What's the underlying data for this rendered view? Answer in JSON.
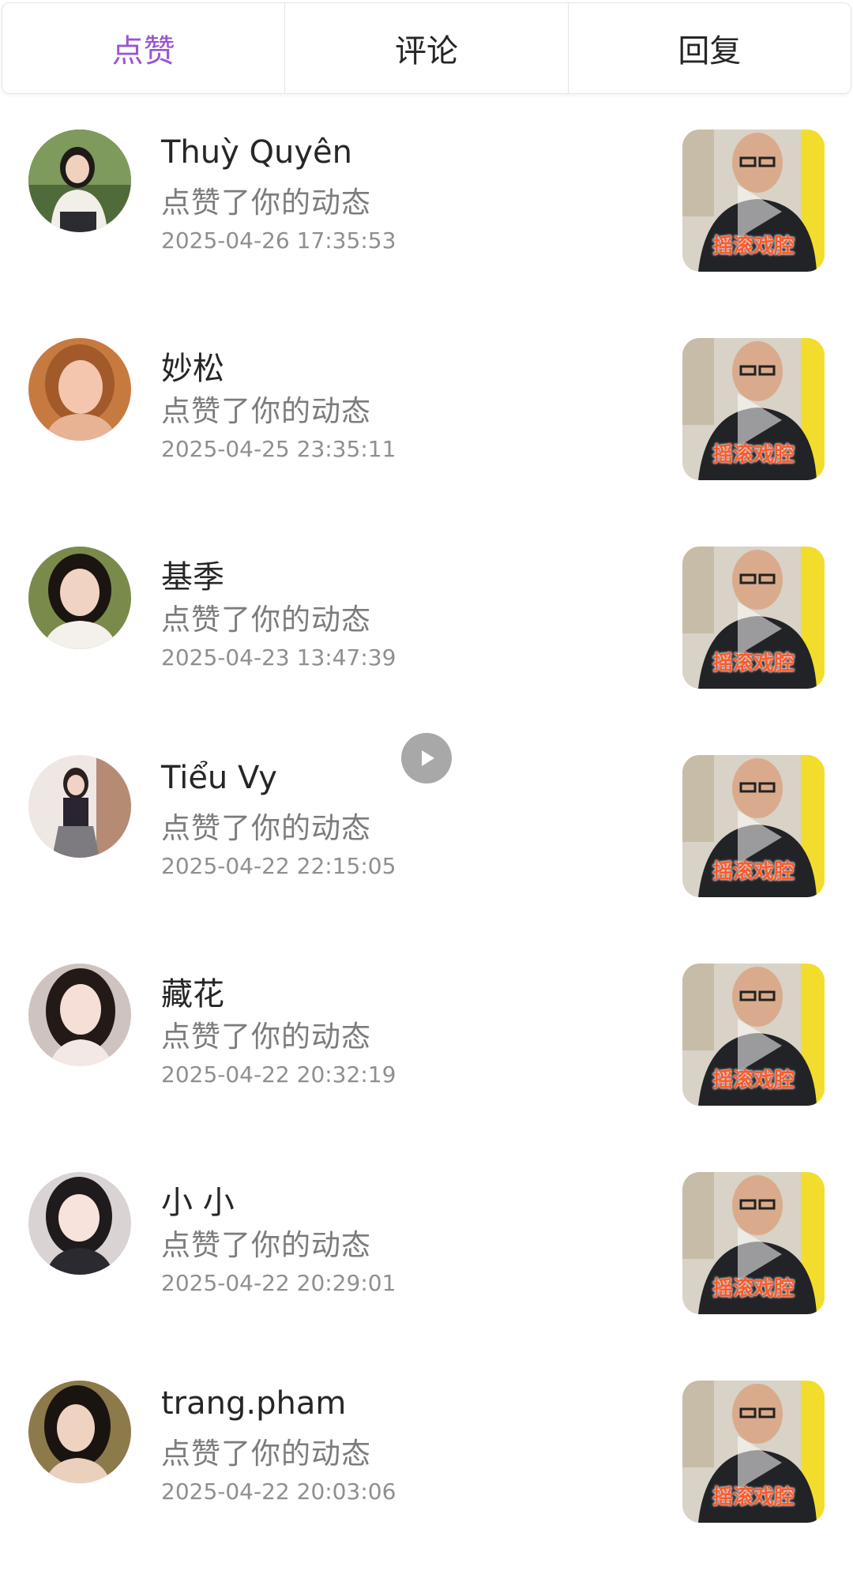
{
  "tabs": [
    {
      "label": "点赞",
      "active": true
    },
    {
      "label": "评论",
      "active": false
    },
    {
      "label": "回复",
      "active": false
    }
  ],
  "accent_color": "#9a55d6",
  "notifications": [
    {
      "name": "Thuỳ Quyên",
      "action": "点赞了你的动态",
      "time": "2025-04-26 17:35:53",
      "thumb_caption": "摇滚戏腔"
    },
    {
      "name": "妙松",
      "action": "点赞了你的动态",
      "time": "2025-04-25 23:35:11",
      "thumb_caption": "摇滚戏腔"
    },
    {
      "name": "基季",
      "action": "点赞了你的动态",
      "time": "2025-04-23 13:47:39",
      "thumb_caption": "摇滚戏腔"
    },
    {
      "name": "Tiểu Vy",
      "action": "点赞了你的动态",
      "time": "2025-04-22 22:15:05",
      "thumb_caption": "摇滚戏腔"
    },
    {
      "name": "藏花",
      "action": "点赞了你的动态",
      "time": "2025-04-22 20:32:19",
      "thumb_caption": "摇滚戏腔"
    },
    {
      "name": "小 小",
      "action": "点赞了你的动态",
      "time": "2025-04-22 20:29:01",
      "thumb_caption": "摇滚戏腔"
    },
    {
      "name": "trang.pham",
      "action": "点赞了你的动态",
      "time": "2025-04-22 20:03:06",
      "thumb_caption": "摇滚戏腔"
    }
  ],
  "icons": {
    "floating": "play-icon",
    "thumbnail_overlay": "play-icon"
  }
}
